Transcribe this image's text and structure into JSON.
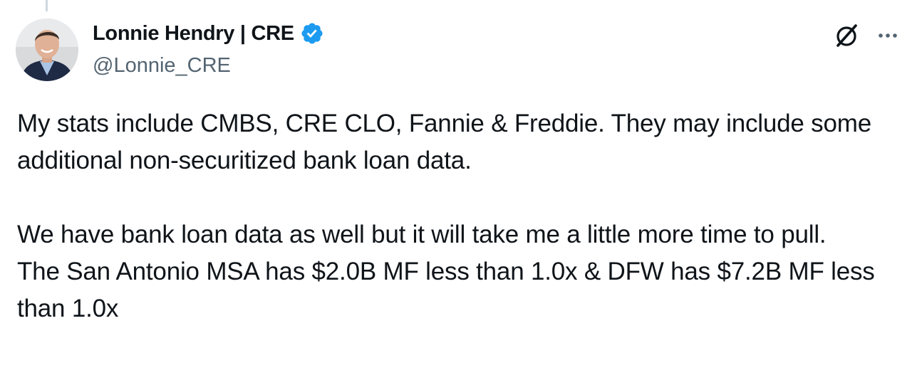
{
  "author": {
    "display_name": "Lonnie Hendry | CRE",
    "handle": "@Lonnie_CRE",
    "verified": true,
    "verified_color": "#1d9bf0"
  },
  "actions": {
    "grok_icon": "grok-icon",
    "more_icon": "more-icon"
  },
  "tweet": {
    "para1": "My stats include CMBS, CRE CLO, Fannie & Freddie. They may include some additional non-securitized bank loan data.",
    "para2": "We have bank loan data as well but it will take me a little more time to pull.",
    "para3": "The San Antonio MSA has $2.0B MF less than 1.0x & DFW has $7.2B MF less than 1.0x"
  },
  "colors": {
    "text": "#0f1419",
    "secondary_text": "#536471",
    "accent": "#1d9bf0"
  }
}
